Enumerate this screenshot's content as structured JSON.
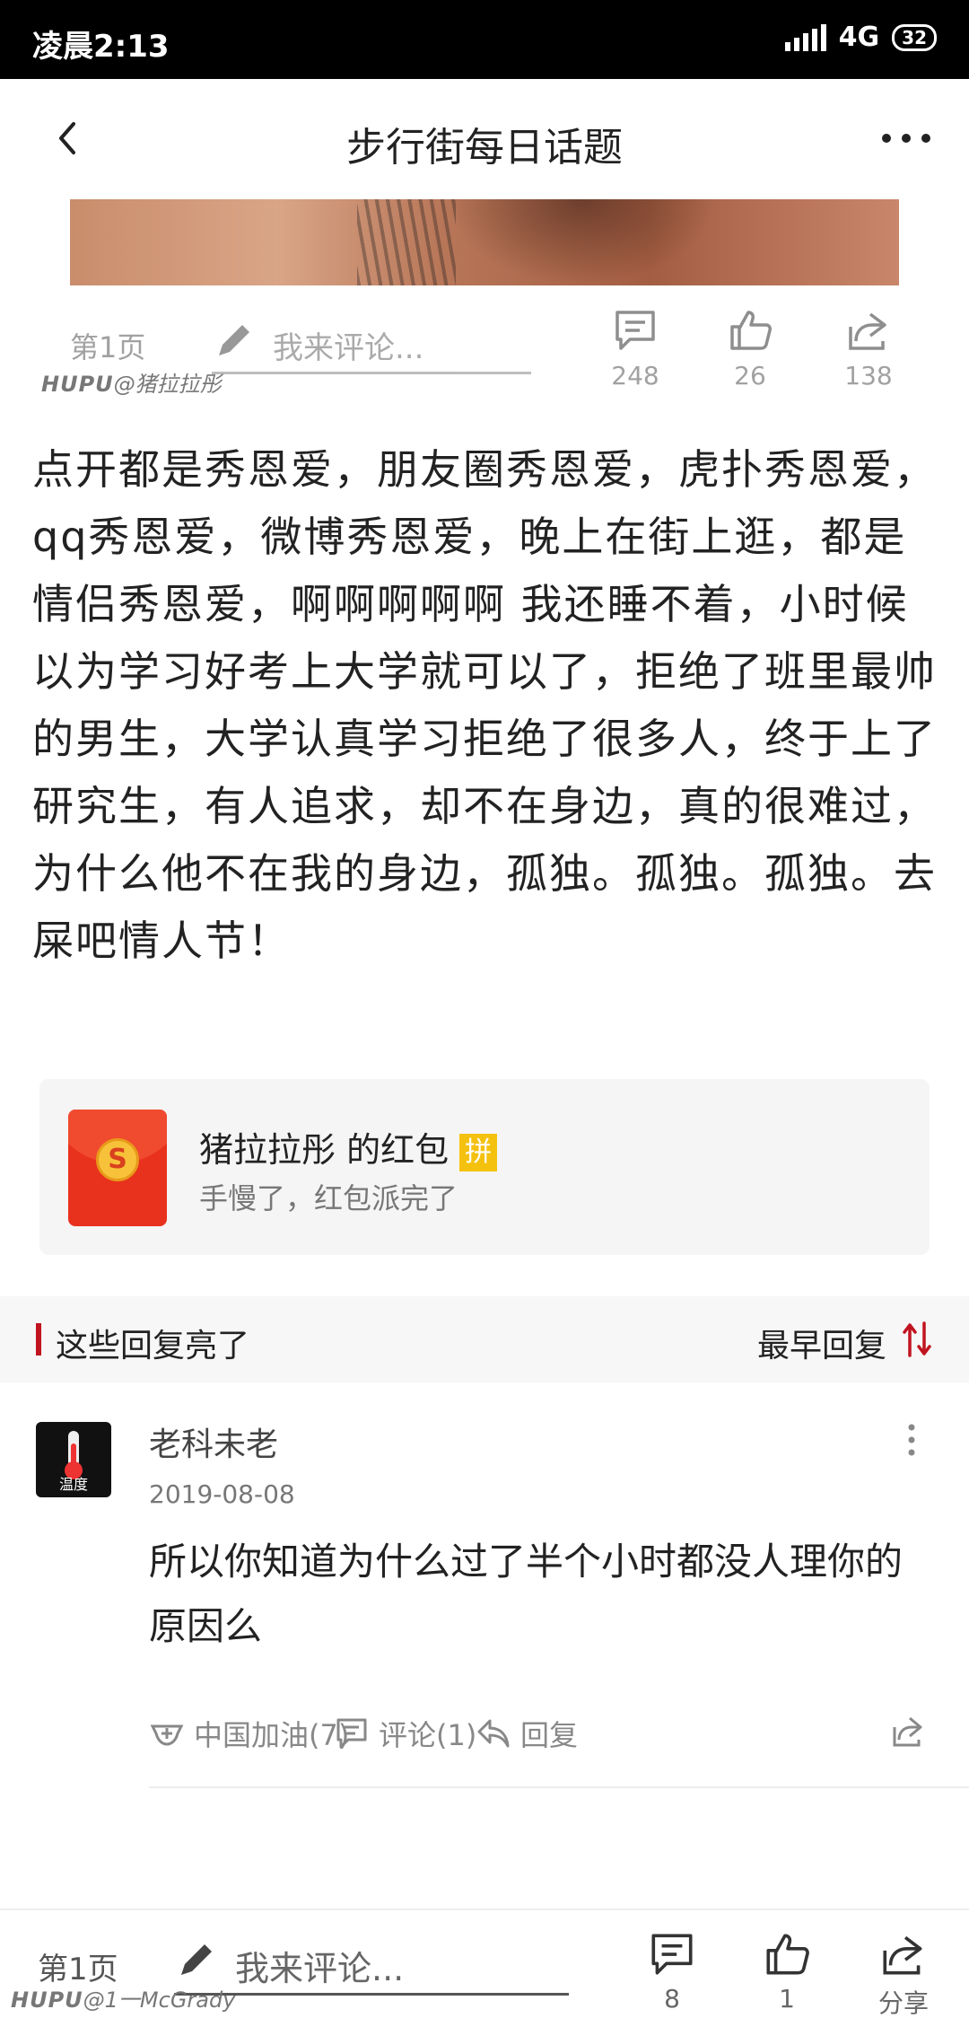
{
  "status_bar": {
    "time": "凌晨2:13",
    "network": "4G",
    "battery": "32"
  },
  "header": {
    "title": "步行街每日话题"
  },
  "mid_bar": {
    "page": "第1页",
    "comment_placeholder": "我来评论...",
    "comments_count": "248",
    "likes_count": "26",
    "share_count": "138",
    "watermark_brand": "HUPU",
    "watermark_user": "@猪拉拉彤"
  },
  "post": {
    "body": "点开都是秀恩爱，朋友圈秀恩爱，虎扑秀恩爱，qq秀恩爱，微博秀恩爱，晚上在街上逛，都是情侣秀恩爱，啊啊啊啊啊 我还睡不着，小时候以为学习好考上大学就可以了，拒绝了班里最帅的男生，大学认真学习拒绝了很多人，终于上了研究生，有人追求，却不在身边，真的很难过，为什么他不在我的身边，孤独。孤独。孤独。去屎吧情人节！"
  },
  "red_packet": {
    "title": "猪拉拉彤 的红包",
    "tag": "拼",
    "subtitle": "手慢了，红包派完了",
    "coin_symbol": "S"
  },
  "replies_section": {
    "label": "这些回复亮了",
    "sort": "最早回复"
  },
  "comment": {
    "avatar_label": "温度",
    "username": "老科未老",
    "date": "2019-08-08",
    "text": "所以你知道为什么过了半个小时都没人理你的原因么",
    "cheer": "中国加油(7)",
    "reply_count": "评论(1)",
    "reply": "回复"
  },
  "bottom_bar": {
    "page": "第1页",
    "comment_placeholder": "我来评论...",
    "comments_count": "8",
    "likes_count": "1",
    "share_label": "分享",
    "watermark_brand": "HUPU",
    "watermark_user": "@1一McGrady"
  },
  "colors": {
    "accent_red": "#c0141f",
    "packet_red": "#e8321d",
    "tag_yellow": "#f5c10f"
  }
}
